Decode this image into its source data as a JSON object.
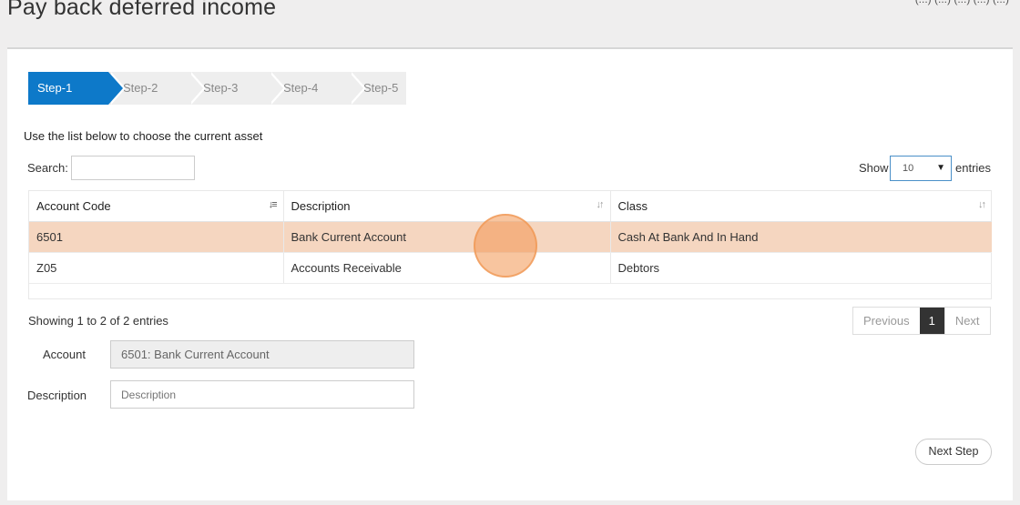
{
  "page": {
    "title": "Pay back deferred income",
    "top_right_text": "(...) (...) (...) (...) (...)"
  },
  "steps": [
    {
      "label": "Step-1",
      "active": true
    },
    {
      "label": "Step-2",
      "active": false
    },
    {
      "label": "Step-3",
      "active": false
    },
    {
      "label": "Step-4",
      "active": false
    },
    {
      "label": "Step-5",
      "active": false
    }
  ],
  "instruction": "Use the list below to choose the current asset",
  "search": {
    "label": "Search:",
    "value": ""
  },
  "length": {
    "show_label": "Show",
    "selected": "10",
    "entries_label": "entries"
  },
  "table": {
    "columns": [
      "Account Code",
      "Description",
      "Class"
    ],
    "rows": [
      {
        "code": "6501",
        "description": "Bank Current Account",
        "class": "Cash At Bank And In Hand",
        "selected": true
      },
      {
        "code": "Z05",
        "description": "Accounts Receivable",
        "class": "Debtors",
        "selected": false
      }
    ]
  },
  "info": "Showing 1 to 2 of 2 entries",
  "pagination": {
    "previous": "Previous",
    "current": "1",
    "next": "Next"
  },
  "form": {
    "account_label": "Account",
    "account_value": "6501: Bank Current Account",
    "description_label": "Description",
    "description_placeholder": "Description"
  },
  "next_step_label": "Next Step",
  "colors": {
    "accent": "#0d79c9",
    "selected_row": "#f5d6c0"
  }
}
